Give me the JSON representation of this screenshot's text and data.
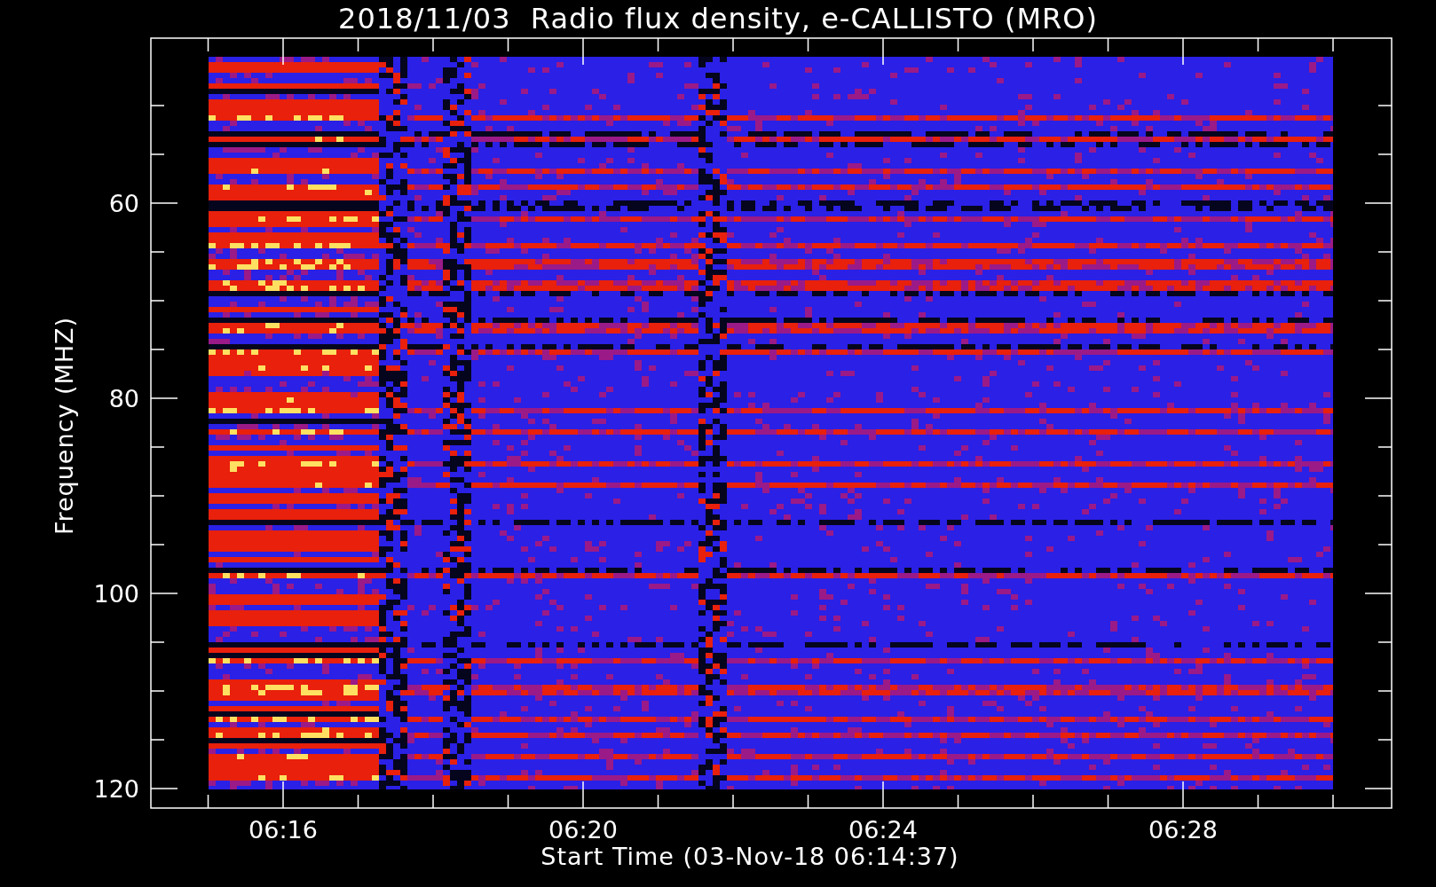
{
  "title": "2018/11/03  Radio flux density, e-CALLISTO (MRO)",
  "ylabel": "Frequency (MHZ)",
  "y_ticks": [
    {
      "label": "60"
    },
    {
      "label": "80"
    },
    {
      "label": "100"
    },
    {
      "label": "120"
    }
  ],
  "x_ticks": [
    {
      "label": "06:16"
    },
    {
      "label": "06:20"
    },
    {
      "label": "06:24"
    },
    {
      "label": "06:28"
    }
  ],
  "xlabel": "Start Time (03-Nov-18 06:14:37)"
}
